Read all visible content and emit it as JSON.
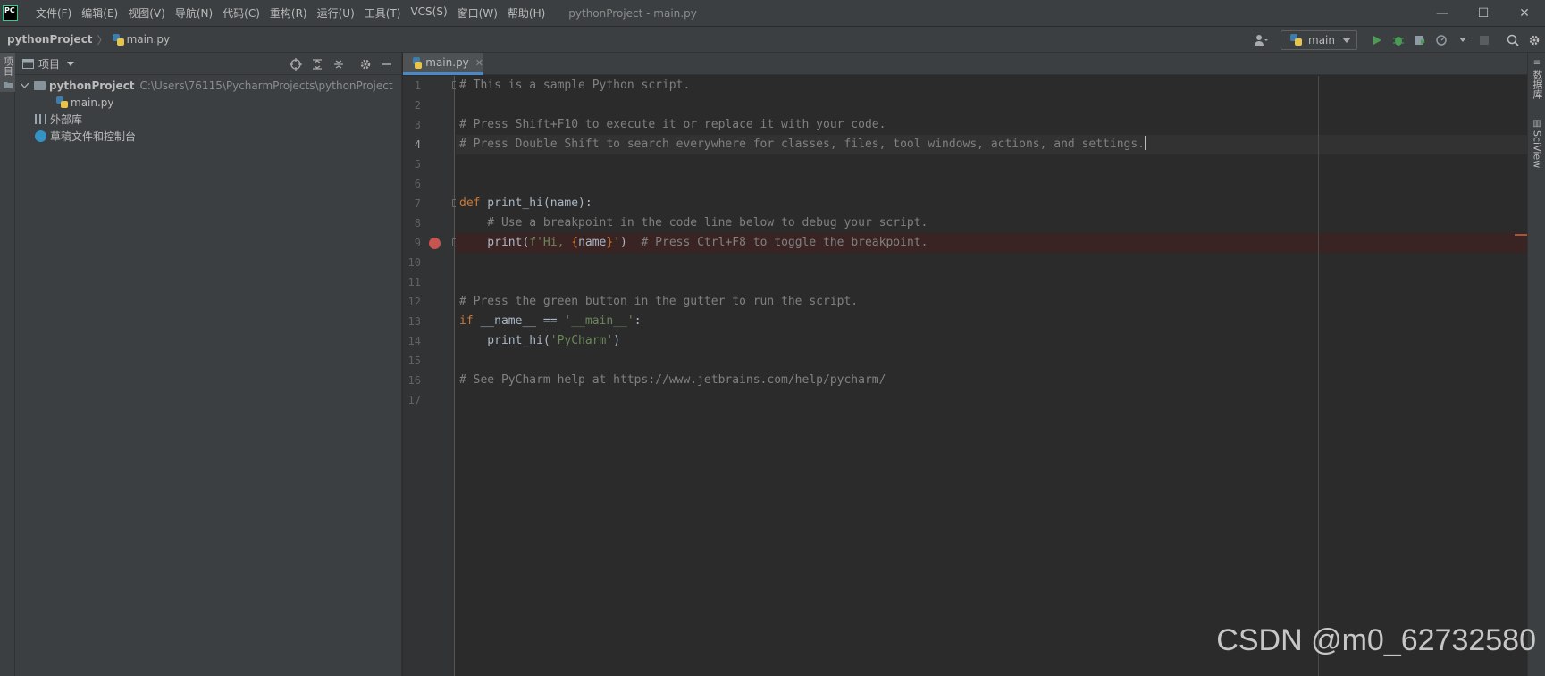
{
  "titlebar": {
    "logo_text": "PC",
    "menu": [
      "文件(F)",
      "编辑(E)",
      "视图(V)",
      "导航(N)",
      "代码(C)",
      "重构(R)",
      "运行(U)",
      "工具(T)",
      "VCS(S)",
      "窗口(W)",
      "帮助(H)"
    ],
    "window_title": "pythonProject - main.py",
    "minimize": "—",
    "maximize": "☐",
    "close": "✕"
  },
  "navbar": {
    "project": "pythonProject",
    "separator": "〉",
    "file": "main.py",
    "run_config": "main"
  },
  "left_stripe": {
    "project_tab": "项目"
  },
  "project_panel": {
    "title": "项目",
    "root_name": "pythonProject",
    "root_path": "C:\\Users\\76115\\PycharmProjects\\pythonProject",
    "file": "main.py",
    "external_libs": "外部库",
    "scratches": "草稿文件和控制台"
  },
  "editor": {
    "tab_label": "main.py",
    "lines": [
      "1",
      "2",
      "3",
      "4",
      "5",
      "6",
      "7",
      "8",
      "9",
      "10",
      "11",
      "12",
      "13",
      "14",
      "15",
      "16",
      "17"
    ],
    "active_line": "4",
    "code": {
      "l1": "# This is a sample Python script.",
      "l3": "# Press Shift+F10 to execute it or replace it with your code.",
      "l4": "# Press Double Shift to search everywhere for classes, files, tool windows, actions, and settings.",
      "l7_kw": "def",
      "l7_rest": " print_hi(name):",
      "l8": "    # Use a breakpoint in the code line below to debug your script.",
      "l9_pre": "    print(",
      "l9_str1": "f'Hi, ",
      "l9_brace_open": "{",
      "l9_name": "name",
      "l9_brace_close": "}",
      "l9_str2": "'",
      "l9_post": ")  ",
      "l9_cmt": "# Press Ctrl+F8 to toggle the breakpoint.",
      "l12": "# Press the green button in the gutter to run the script.",
      "l13_kw": "if",
      "l13_mid": " __name__ == ",
      "l13_str": "'__main__'",
      "l13_end": ":",
      "l14_pre": "    print_hi(",
      "l14_str": "'PyCharm'",
      "l14_end": ")",
      "l16": "# See PyCharm help at https://www.jetbrains.com/help/pycharm/"
    }
  },
  "right_stripe": {
    "database": "数据库",
    "sciview": "SciView"
  },
  "watermark": "CSDN @m0_62732580",
  "colors": {
    "accent": "#4a88c7",
    "keyword": "#cc7832",
    "string": "#6a8759",
    "comment": "#808080",
    "breakpoint": "#c75450",
    "run_green": "#499c54"
  }
}
